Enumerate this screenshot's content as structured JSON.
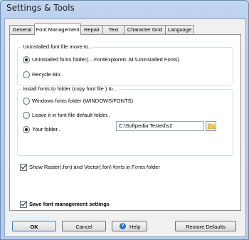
{
  "window": {
    "title": "Settings & Tools"
  },
  "tabs": [
    {
      "label": "General"
    },
    {
      "label": "Font Management"
    },
    {
      "label": "Repair"
    },
    {
      "label": "Text"
    },
    {
      "label": "Character Grid"
    },
    {
      "label": "Language"
    }
  ],
  "uninstall_group": {
    "label": "Uninstalled font file move to..",
    "options": [
      {
        "label": "Uninstalled fonts folder(....FontExplorerL.M.\\Uninstalled Fonts)",
        "selected": true
      },
      {
        "label": "Recycle Bin..",
        "selected": false
      }
    ]
  },
  "install_group": {
    "label": "Install fonts to folder (copy font file ) to...",
    "options": [
      {
        "label": "Windows fonts folder (WINDOWS\\FONTS)",
        "selected": false
      },
      {
        "label": "Leave it in font file default folder..",
        "selected": false
      },
      {
        "label": "Your folder..",
        "selected": true
      }
    ],
    "folder_value": "C:\\Softpedia Tested\\s2"
  },
  "show_raster": {
    "label": "Show Raster(.fon) and Vector(.fon) fonts in Fonts folder",
    "checked": true
  },
  "watermark": "www.softpedia.com",
  "save_settings": {
    "label": "Save font management settings",
    "checked": true
  },
  "buttons": {
    "ok": "OK",
    "cancel": "Cancel",
    "help": "Help",
    "restore": "Restore Defaults"
  },
  "icons": {
    "help": "help-icon",
    "folder": "folder-icon"
  }
}
